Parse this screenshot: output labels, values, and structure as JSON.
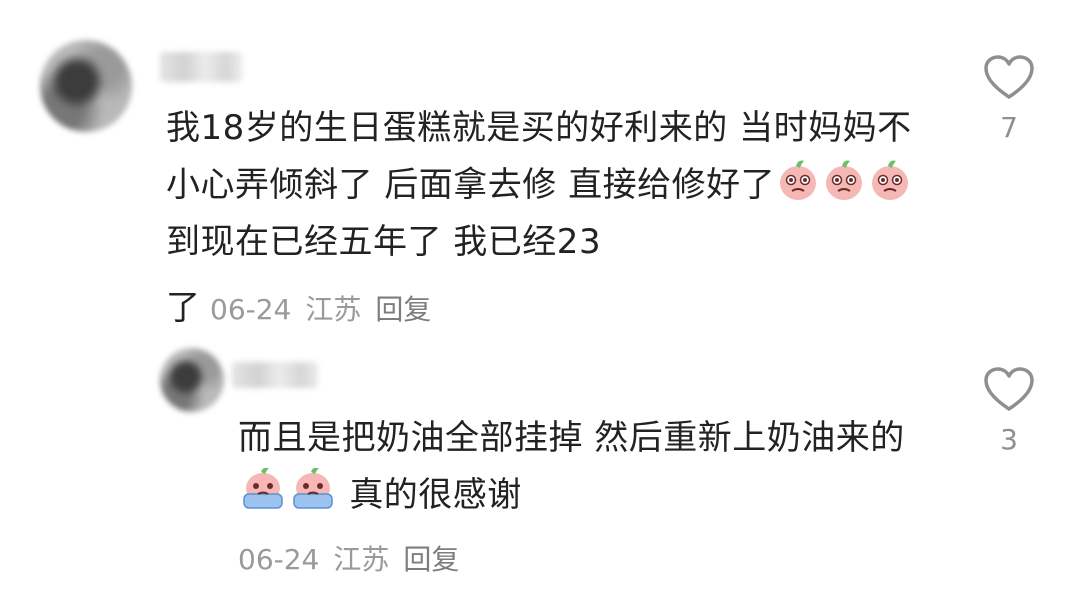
{
  "comments": [
    {
      "text_before_emoji": "我18岁的生日蛋糕就是买的好利来的 当时妈妈不小心弄倾斜了 后面拿去修 直接给修好了",
      "emoji": [
        "peach-cry-emoji",
        "peach-cry-emoji",
        "peach-cry-emoji"
      ],
      "text_after_emoji": "到现在已经五年了 我已经23",
      "text_tail": "了",
      "date": "06-24",
      "location": "江苏",
      "reply_label": "回复",
      "likes": "7"
    },
    {
      "text_before_emoji": "而且是把奶油全部挂掉 然后重新上奶油来的",
      "emoji": [
        "peach-tearful-emoji",
        "peach-tearful-emoji"
      ],
      "text_after_emoji": "真的很感谢",
      "date": "06-24",
      "location": "江苏",
      "reply_label": "回复",
      "likes": "3"
    }
  ],
  "colors": {
    "text": "#222222",
    "meta": "#9a9a9a",
    "heart": "#8f8f8f"
  }
}
